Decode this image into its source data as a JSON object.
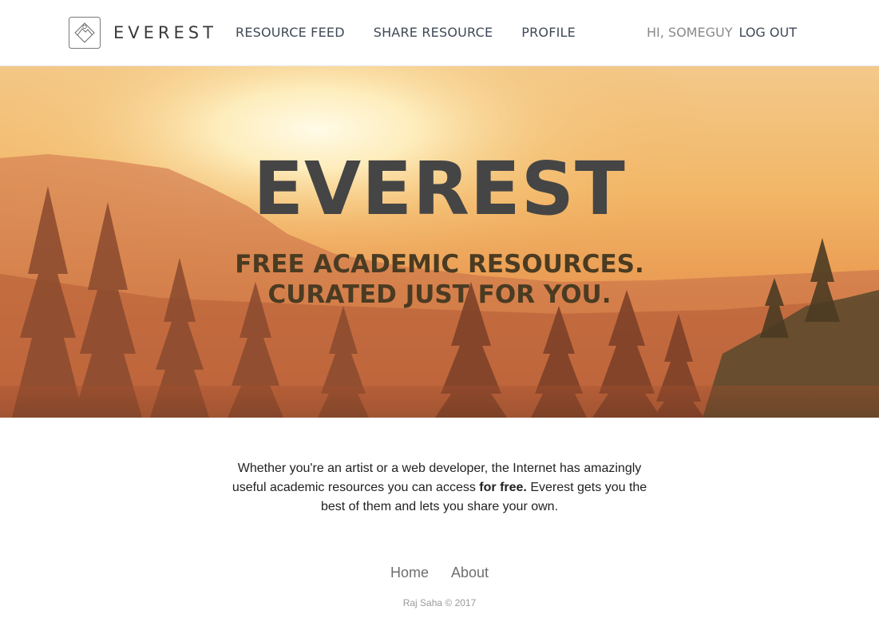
{
  "header": {
    "logo_text": "EVEREST",
    "logo_icon": "everest-diamond-mountain-logo",
    "nav": [
      {
        "label": "RESOURCE FEED"
      },
      {
        "label": "SHARE RESOURCE"
      },
      {
        "label": "PROFILE"
      }
    ],
    "greeting": "HI, SOMEGUY",
    "logout_label": "LOG OUT"
  },
  "hero": {
    "title": "EVEREST",
    "subtitle_line1": "FREE ACADEMIC RESOURCES.",
    "subtitle_line2": "CURATED JUST FOR YOU.",
    "background": "sunset-forest-mountains-photo"
  },
  "intro": {
    "text_before": "Whether you're an artist or a web developer, the Internet has amazingly useful academic resources you can access ",
    "bold_text": "for free.",
    "text_after": " Everest gets you the best of them and lets you share your own."
  },
  "footer": {
    "links": [
      {
        "label": "Home"
      },
      {
        "label": "About"
      }
    ],
    "copyright": "Raj Saha © 2017"
  },
  "colors": {
    "nav_text": "#3f4a57",
    "greeting_text": "#8a8a8a",
    "hero_title": "#454545",
    "hero_subtitle": "#4a3b22",
    "footer_link": "#6f6f6f"
  }
}
